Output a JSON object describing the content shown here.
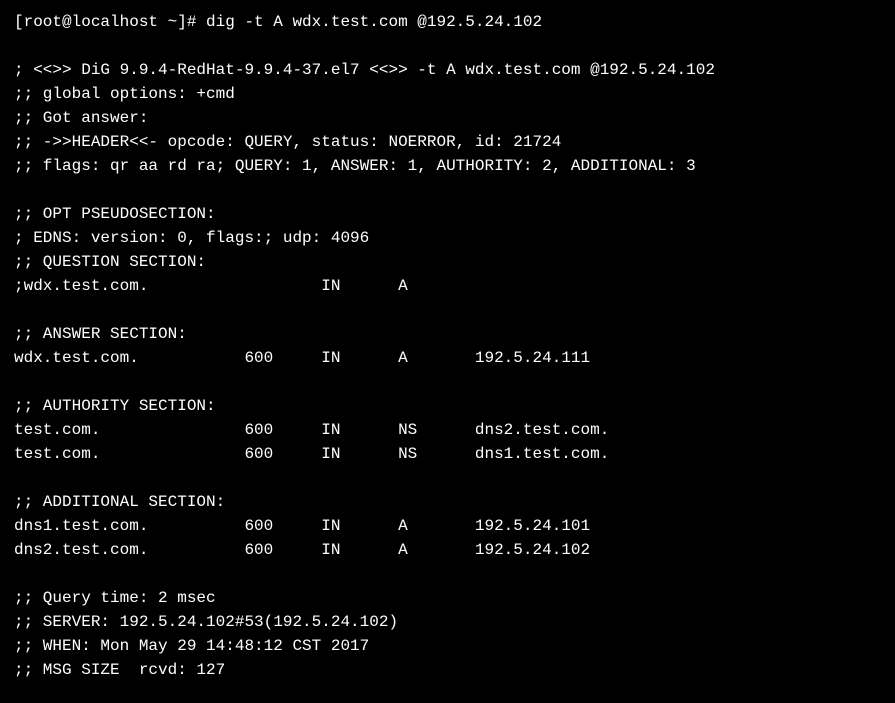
{
  "terminal": {
    "lines": [
      "[root@localhost ~]# dig -t A wdx.test.com @192.5.24.102",
      "",
      "; <<>> DiG 9.9.4-RedHat-9.9.4-37.el7 <<>> -t A wdx.test.com @192.5.24.102",
      ";; global options: +cmd",
      ";; Got answer:",
      ";; ->>HEADER<<- opcode: QUERY, status: NOERROR, id: 21724",
      ";; flags: qr aa rd ra; QUERY: 1, ANSWER: 1, AUTHORITY: 2, ADDITIONAL: 3",
      "",
      ";; OPT PSEUDOSECTION:",
      "; EDNS: version: 0, flags:; udp: 4096",
      ";; QUESTION SECTION:",
      ";wdx.test.com.                  IN      A",
      "",
      ";; ANSWER SECTION:",
      "wdx.test.com.           600     IN      A       192.5.24.111",
      "",
      ";; AUTHORITY SECTION:",
      "test.com.               600     IN      NS      dns2.test.com.",
      "test.com.               600     IN      NS      dns1.test.com.",
      "",
      ";; ADDITIONAL SECTION:",
      "dns1.test.com.          600     IN      A       192.5.24.101",
      "dns2.test.com.          600     IN      A       192.5.24.102",
      "",
      ";; Query time: 2 msec",
      ";; SERVER: 192.5.24.102#53(192.5.24.102)",
      ";; WHEN: Mon May 29 14:48:12 CST 2017",
      ";; MSG SIZE  rcvd: 127"
    ]
  }
}
